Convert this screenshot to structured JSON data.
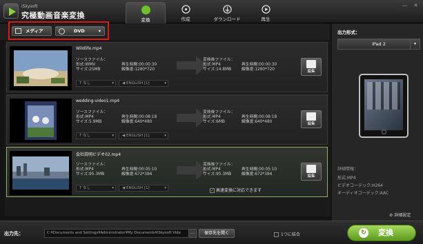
{
  "app": {
    "brand_small": "iSkysoft",
    "brand_big": "究極動画音楽変換"
  },
  "tabs": [
    {
      "label": "変換",
      "icon": "convert-icon",
      "active": true
    },
    {
      "label": "作成",
      "icon": "disc-icon"
    },
    {
      "label": "ダウンロード",
      "icon": "download-icon"
    },
    {
      "label": "再生",
      "icon": "play-icon"
    }
  ],
  "window": {
    "minimize": "—",
    "close": "✕"
  },
  "toolbar": {
    "media_label": "メディア",
    "dvd_label": "DVD"
  },
  "files": [
    {
      "name": "Wildlife.mp4",
      "src_label": "ソースファイル：",
      "src_format": "形式:WMV",
      "src_size": "サイズ:25MB",
      "src_duration": "再生時間:00:00:30",
      "src_resolution": "解像度:1280*720",
      "out_label": "変換後ファイル：",
      "out_format": "形式:MP4",
      "out_size": "サイズ:14.8MB",
      "out_duration": "再生時間:00:00:30",
      "out_resolution": "解像度:1280*720",
      "subtitle": "なし",
      "audio": "ENGLISH [1]",
      "edit": "編集"
    },
    {
      "name": "wedding-video1.mp4",
      "src_label": "ソースファイル：",
      "src_format": "形式:MP4",
      "src_size": "サイズ:5.9MB",
      "src_duration": "再生時間:00:08:18",
      "src_resolution": "解像度:640*480",
      "out_label": "変換後ファイル：",
      "out_format": "形式:MP4",
      "out_size": "サイズ:6MB",
      "out_duration": "再生時間:00:08:18",
      "out_resolution": "解像度:640*480",
      "subtitle": "なし",
      "audio": "ENGLISH [1]",
      "edit": "編集"
    },
    {
      "name": "会社説明ビデオ02.mp4",
      "src_label": "ソースファイル：",
      "src_format": "形式:MP4",
      "src_size": "サイズ:95.3MB",
      "src_duration": "再生時間:00:05:10",
      "src_resolution": "解像度:672*384",
      "out_label": "変換後ファイル：",
      "out_format": "形式:MP4",
      "out_size": "サイズ:95.3MB",
      "out_duration": "再生時間:00:05:10",
      "out_resolution": "解像度:672*384",
      "subtitle": "なし",
      "audio": "ENGLISH [1]",
      "edit": "編集",
      "fast_convert": "高速変換に対応できます"
    }
  ],
  "right_panel": {
    "output_label": "出力形式：",
    "format": "iPad 2",
    "details_header": "詳細情報：",
    "details": [
      "形式:MP4",
      "ビデオコーデック:H264",
      "オーディオコーデック:AAC"
    ],
    "advanced": "詳細設定"
  },
  "bottom": {
    "output_dir_label": "出力先：",
    "path": "C:¥Documents and Settings¥Administrator¥My Documents¥iSkysoft Vide",
    "ellipsis": "...",
    "open_folder": "保存先を開く",
    "merge": "1つに結合",
    "convert": "変換"
  },
  "colors": {
    "accent_green": "#6fbf2a",
    "highlight_red": "#e01818"
  }
}
